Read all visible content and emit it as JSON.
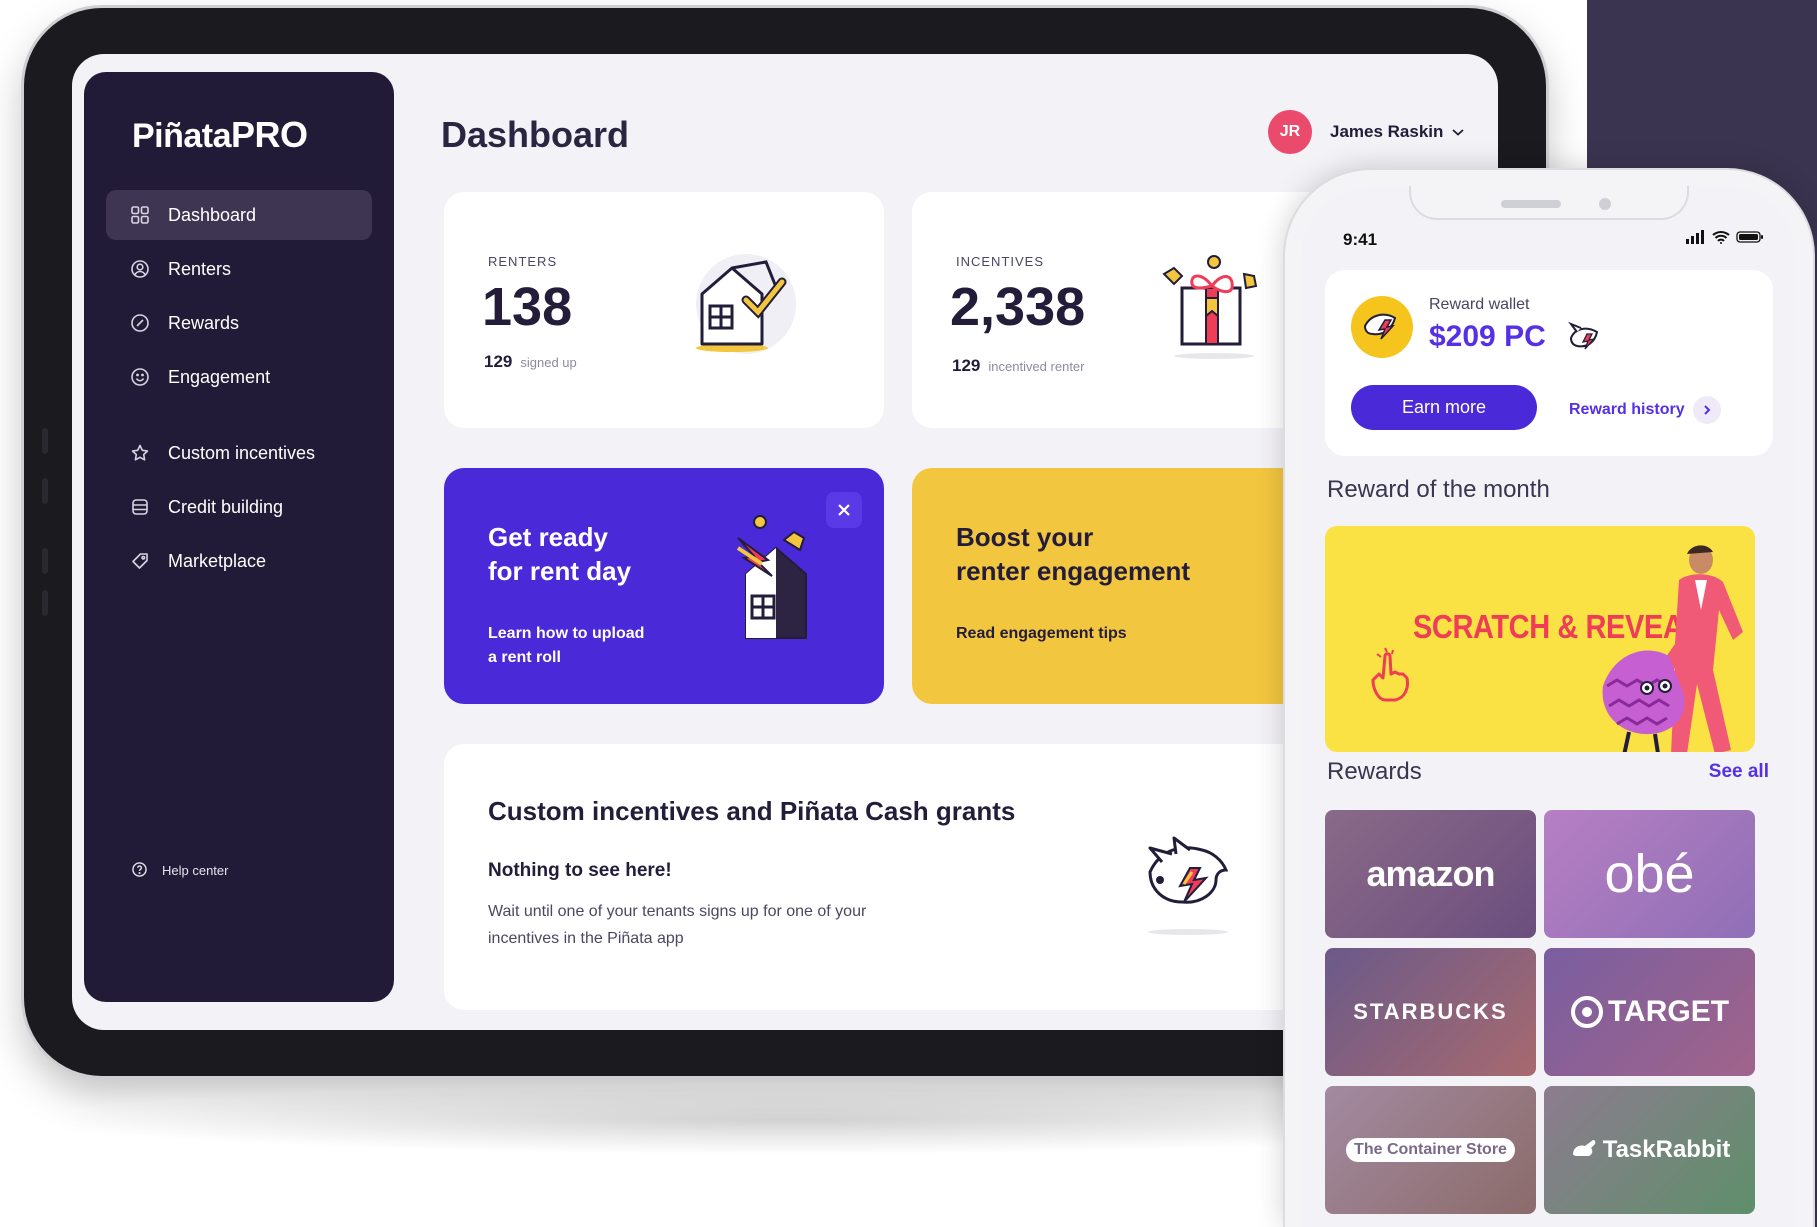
{
  "colors": {
    "sidebar_bg": "#221b37",
    "accent_purple": "#4a29d8",
    "accent_yellow": "#f3c63f",
    "avatar_pink": "#ea4a6b",
    "reward_purple": "#5530e6"
  },
  "sidebar": {
    "logo_main": "Piñata",
    "logo_pro": "PRO",
    "items": [
      {
        "label": "Dashboard",
        "icon": "grid-icon"
      },
      {
        "label": "Renters",
        "icon": "user-circle-icon"
      },
      {
        "label": "Rewards",
        "icon": "reward-icon"
      },
      {
        "label": "Engagement",
        "icon": "smile-icon"
      },
      {
        "label": "Custom incentives",
        "icon": "star-icon"
      },
      {
        "label": "Credit building",
        "icon": "database-icon"
      },
      {
        "label": "Marketplace",
        "icon": "tag-icon"
      }
    ],
    "help": "Help center"
  },
  "header": {
    "title": "Dashboard",
    "user_initials": "JR",
    "user_name": "James Raskin"
  },
  "stats": {
    "renters": {
      "label": "RENTERS",
      "value": "138",
      "sub_value": "129",
      "sub_label": "signed up"
    },
    "incentives": {
      "label": "INCENTIVES",
      "value": "2,338",
      "sub_value": "129",
      "sub_label": "incentived renter"
    }
  },
  "promos": {
    "rent_day": {
      "title_line1": "Get ready",
      "title_line2": "for rent day",
      "link_line1": "Learn how to upload",
      "link_line2": "a rent roll"
    },
    "engagement": {
      "title_line1": "Boost your",
      "title_line2": "renter engagement",
      "link": "Read engagement tips"
    }
  },
  "custom_incentives": {
    "title": "Custom incentives and Piñata Cash grants",
    "empty_title": "Nothing to see here!",
    "empty_body": "Wait until one of your tenants signs up for one of your incentives in the Piñata app"
  },
  "phone": {
    "time": "9:41",
    "wallet_label": "Reward wallet",
    "wallet_value": "$209 PC",
    "earn_more": "Earn more",
    "reward_history": "Reward history",
    "reward_of_month_title": "Reward of the month",
    "reward_of_month_text": "SCRATCH & REVEAL",
    "rewards_title": "Rewards",
    "see_all": "See all",
    "brands": [
      "amazon",
      "obé",
      "STARBUCKS",
      "TARGET",
      "The Container Store",
      "TaskRabbit"
    ]
  }
}
